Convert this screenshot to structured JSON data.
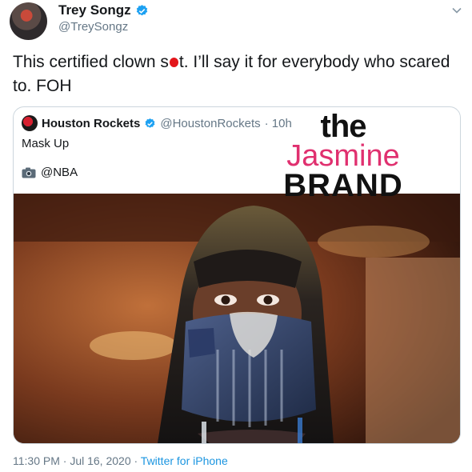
{
  "tweet": {
    "author_name": "Trey Songz",
    "author_handle": "@TreySongz",
    "text_before": "This certified clown s",
    "text_after": "t. I’ll say it for everybody who scared to. FOH",
    "timestamp": "11:30 PM · Jul 16, 2020 · ",
    "source": "Twitter for iPhone"
  },
  "quote": {
    "author_name": "Houston Rockets",
    "author_handle": "@HoustonRockets",
    "age": "· 10h",
    "text": "Mask Up",
    "credit": "@NBA"
  },
  "watermark": {
    "line1": "the",
    "line2": "Jasmine",
    "line3": "BRAND"
  },
  "colors": {
    "verified": "#1da1f2",
    "link": "#1b95e0",
    "brand_pink": "#e0306f"
  }
}
